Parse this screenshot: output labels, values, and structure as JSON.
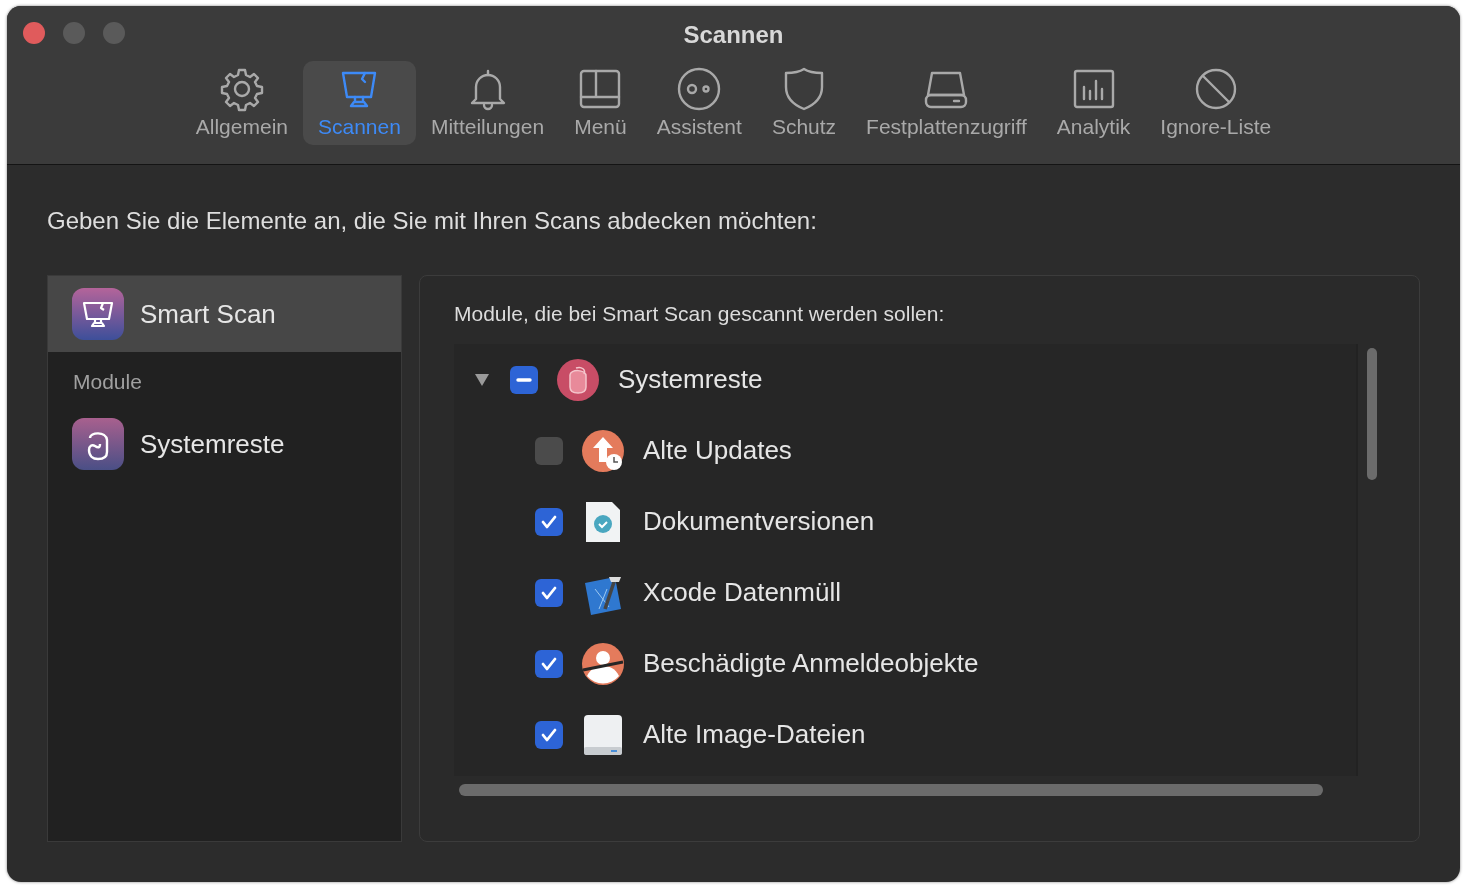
{
  "window": {
    "title": "Scannen"
  },
  "toolbar": [
    {
      "label": "Allgemein",
      "selected": false
    },
    {
      "label": "Scannen",
      "selected": true
    },
    {
      "label": "Mitteilungen",
      "selected": false
    },
    {
      "label": "Menü",
      "selected": false
    },
    {
      "label": "Assistent",
      "selected": false
    },
    {
      "label": "Schutz",
      "selected": false
    },
    {
      "label": "Festplattenzugriff",
      "selected": false
    },
    {
      "label": "Analytik",
      "selected": false
    },
    {
      "label": "Ignore-Liste",
      "selected": false
    }
  ],
  "instruction": "Geben Sie die Elemente an, die Sie mit Ihren Scans abdecken möchten:",
  "sidebar": {
    "top": {
      "label": "Smart Scan",
      "selected": true
    },
    "section": "Module",
    "items": [
      {
        "label": "Systemreste",
        "selected": false
      }
    ]
  },
  "modules": {
    "heading": "Module, die bei Smart Scan gescannt werden sollen:",
    "tree": [
      {
        "label": "Systemreste",
        "expanded": true,
        "checked": true,
        "mixed": true,
        "children": [
          {
            "label": "Alte Updates",
            "checked": false
          },
          {
            "label": "Dokumentversionen",
            "checked": true
          },
          {
            "label": "Xcode Datenmüll",
            "checked": true
          },
          {
            "label": "Beschädigte Anmeldeobjekte",
            "checked": true
          },
          {
            "label": "Alte Image-Dateien",
            "checked": true
          }
        ]
      }
    ]
  }
}
